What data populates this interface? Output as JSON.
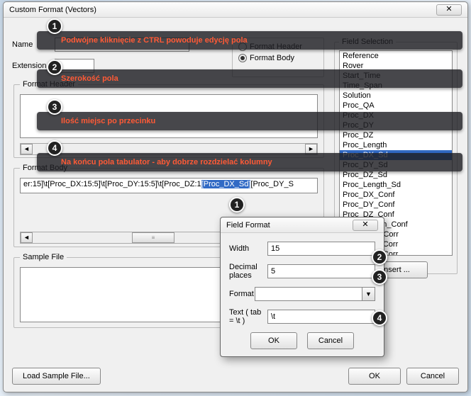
{
  "window": {
    "title": "Custom Format (Vectors)"
  },
  "left": {
    "name_label": "Name",
    "name_value": "",
    "ext_label": "Extension",
    "ext_value": ""
  },
  "radios": {
    "legend": "",
    "header_label": "Format Header",
    "body_label": "Format Body",
    "selected": "body"
  },
  "format_header": {
    "legend": "Format Header",
    "value": ""
  },
  "format_body": {
    "legend": "Format Body",
    "value_pre": "er:15]\\t[Proc_DX:15:5]\\t[Proc_DY:15:5]\\t[Proc_DZ:1",
    "value_sel": "[Proc_DX_Sd]",
    "value_post": "[Proc_DY_S"
  },
  "sample": {
    "legend": "Sample File"
  },
  "buttons": {
    "load_sample": "Load Sample File...",
    "ok": "OK",
    "cancel": "Cancel",
    "insert": "Insert ..."
  },
  "field_selection": {
    "legend": "Field Selection",
    "items": [
      "Reference",
      "Rover",
      "Start_Time",
      "Time_Span",
      "Solution",
      "Proc_QA",
      "Proc_DX",
      "Proc_DY",
      "Proc_DZ",
      "Proc_Length",
      "Proc_DX_Sd",
      "Proc_DY_Sd",
      "Proc_DZ_Sd",
      "Proc_Length_Sd",
      "Proc_DX_Conf",
      "Proc_DY_Conf",
      "Proc_DZ_Conf",
      "Proc_Length_Conf",
      "Proc_DXY_Corr",
      "Proc_DXZ_Corr",
      "Proc_DYZ_Corr"
    ],
    "selected_index": 10
  },
  "dialog": {
    "title": "Field Format",
    "width_label": "Width",
    "width_value": "15",
    "dec_label": "Decimal places",
    "dec_value": "5",
    "format_label": "Format",
    "format_value": "",
    "text_label": "Text ( tab = \\t )",
    "text_value": "\\t",
    "ok": "OK",
    "cancel": "Cancel"
  },
  "annotations": {
    "a1": "Podwójne kliknięcie z CTRL powoduje edycję pola",
    "a2": "Szerokość pola",
    "a3": "Ilość miejsc po przecinku",
    "a4": "Na końcu pola tabulator - aby dobrze rozdzielać kolumny"
  }
}
